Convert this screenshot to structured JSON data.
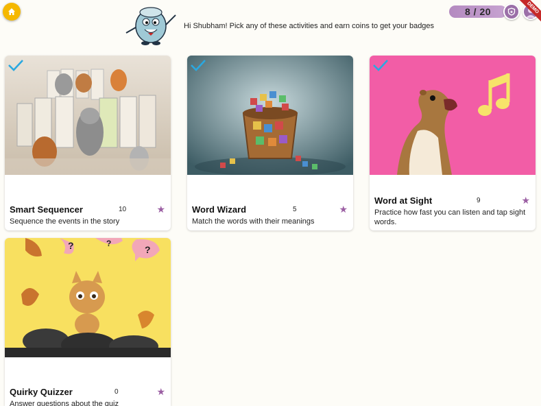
{
  "header": {
    "greeting": "Hi Shubham! Pick any of these activities and earn coins to get your badges",
    "progress": "8 / 20",
    "ribbon": "DEMO",
    "icons": {
      "home": "home-icon",
      "shield": "shield-icon",
      "avatar": "avatar-icon"
    }
  },
  "colors": {
    "accent": "#9b5fa3",
    "check": "#2aa8e0",
    "home": "#f5b800",
    "pink_bg": "#f25da6",
    "yellow_bg": "#f8e060"
  },
  "activities": [
    {
      "title": "Smart Sequencer",
      "coins": "10",
      "description": "Sequence the events in the story",
      "completed": true
    },
    {
      "title": "Word Wizard",
      "coins": "5",
      "description": "Match the words with their meanings",
      "completed": true
    },
    {
      "title": "Word at Sight",
      "coins": "9",
      "description": "Practice how fast you can listen and tap sight words.",
      "completed": true
    },
    {
      "title": "Quirky Quizzer",
      "coins": "0",
      "description": "Answer questions about the quiz",
      "completed": false
    }
  ]
}
